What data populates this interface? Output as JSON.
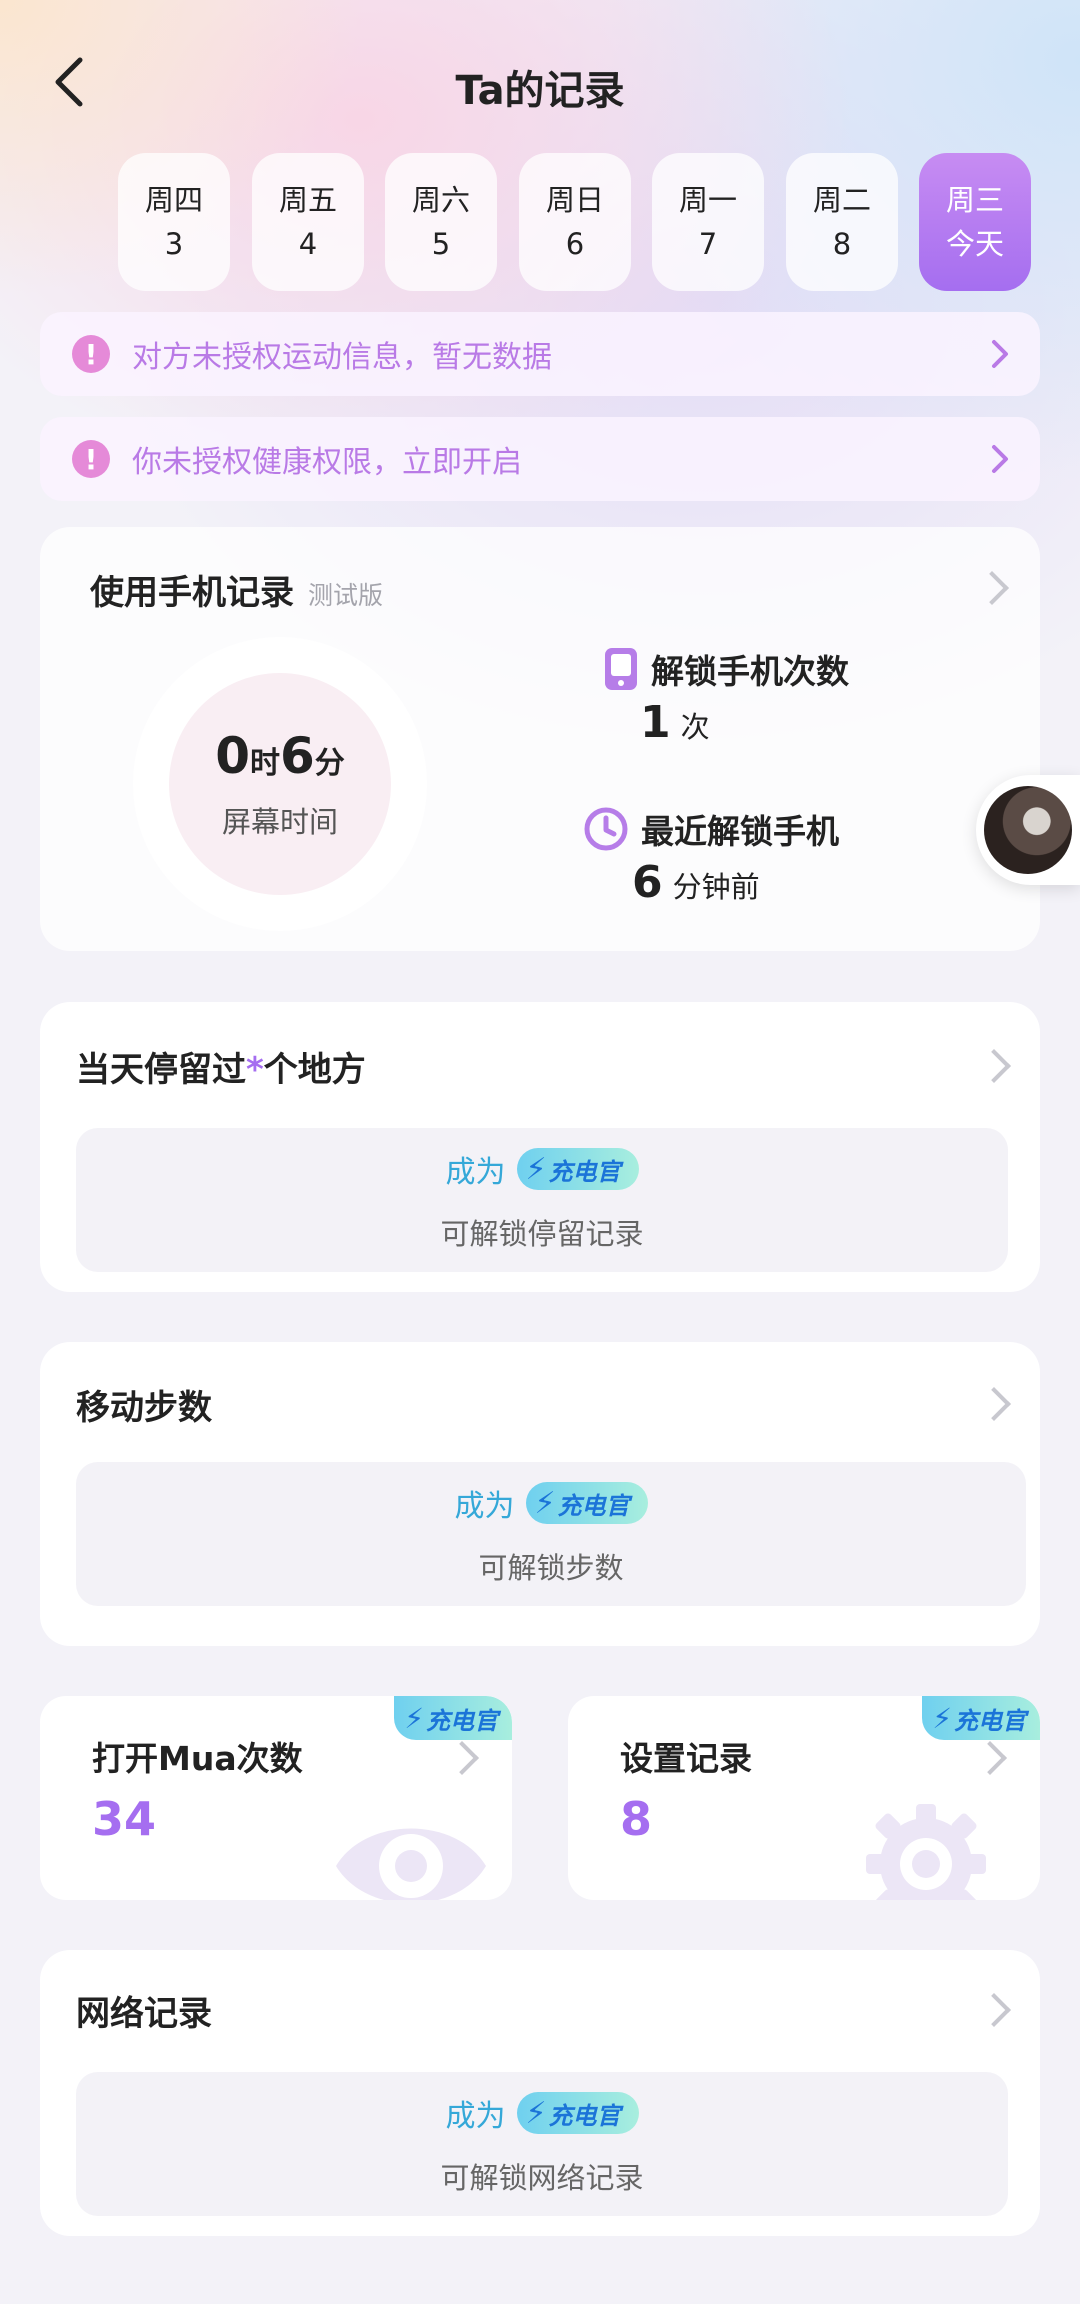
{
  "header": {
    "title": "Ta的记录"
  },
  "days": [
    {
      "weekday": "周四",
      "date": "3",
      "active": false
    },
    {
      "weekday": "周五",
      "date": "4",
      "active": false
    },
    {
      "weekday": "周六",
      "date": "5",
      "active": false
    },
    {
      "weekday": "周日",
      "date": "6",
      "active": false
    },
    {
      "weekday": "周一",
      "date": "7",
      "active": false
    },
    {
      "weekday": "周二",
      "date": "8",
      "active": false
    },
    {
      "weekday": "周三",
      "date": "今天",
      "active": true
    }
  ],
  "notices": [
    {
      "text": "对方未授权运动信息，暂无数据"
    },
    {
      "text": "你未授权健康权限，立即开启"
    }
  ],
  "phone_usage": {
    "title": "使用手机记录",
    "badge": "测试版",
    "hours": "0",
    "hours_unit": "时",
    "minutes": "6",
    "minutes_unit": "分",
    "screen_time_label": "屏幕时间",
    "unlock_count_label": "解锁手机次数",
    "unlock_count": "1",
    "unlock_count_unit": "次",
    "last_unlock_label": "最近解锁手机",
    "last_unlock_value": "6",
    "last_unlock_unit": "分钟前"
  },
  "places": {
    "title_prefix": "当天停留过",
    "title_star": "*",
    "title_suffix": "个地方",
    "become": "成为",
    "vip": "充电官",
    "desc": "可解锁停留记录"
  },
  "steps": {
    "title": "移动步数",
    "become": "成为",
    "vip": "充电官",
    "desc": "可解锁步数"
  },
  "mua_opens": {
    "title": "打开Mua次数",
    "value": "34",
    "badge": "充电官"
  },
  "settings_record": {
    "title": "设置记录",
    "value": "8",
    "badge": "充电官"
  },
  "network": {
    "title": "网络记录",
    "become": "成为",
    "vip": "充电官",
    "desc": "可解锁网络记录"
  },
  "colors": {
    "accent": "#a56ef0",
    "notice_text": "#b97ae6",
    "vip_text": "#1b74d8"
  }
}
